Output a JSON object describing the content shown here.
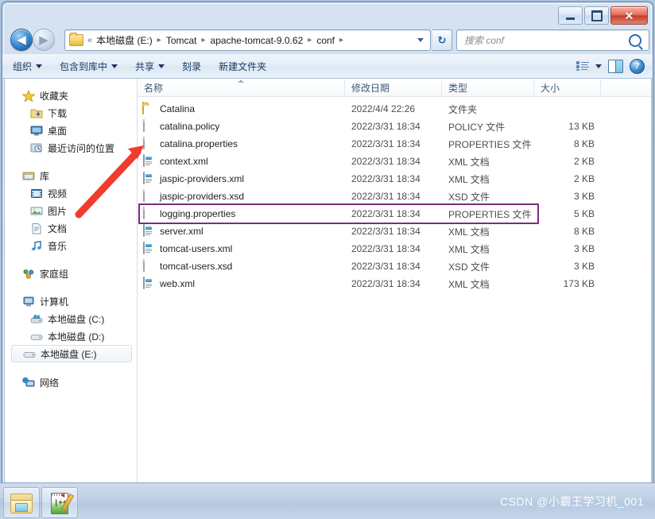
{
  "window": {
    "controls": {
      "minimize_label": "–",
      "maximize_label": "□",
      "close_label": "✕"
    }
  },
  "nav": {
    "back_label": "◀",
    "forward_label": "▶",
    "address": {
      "prefix": "«",
      "crumbs": [
        "本地磁盘 (E:)",
        "Tomcat",
        "apache-tomcat-9.0.62",
        "conf"
      ],
      "separator": "▸"
    },
    "refresh_label": "↻",
    "search": {
      "placeholder": "搜索 conf",
      "value": ""
    }
  },
  "toolbar": {
    "items": [
      {
        "label": "组织",
        "has_caret": true
      },
      {
        "label": "包含到库中",
        "has_caret": true
      },
      {
        "label": "共享",
        "has_caret": true
      },
      {
        "label": "刻录",
        "has_caret": false
      },
      {
        "label": "新建文件夹",
        "has_caret": false
      }
    ],
    "help_label": "?"
  },
  "sidebar": {
    "groups": [
      {
        "header": {
          "label": "收藏夹",
          "icon": "star-icon"
        },
        "items": [
          {
            "label": "下载",
            "icon": "downloads-icon"
          },
          {
            "label": "桌面",
            "icon": "desktop-icon"
          },
          {
            "label": "最近访问的位置",
            "icon": "recent-places-icon"
          }
        ]
      },
      {
        "header": {
          "label": "库",
          "icon": "library-icon"
        },
        "items": [
          {
            "label": "视频",
            "icon": "videos-icon"
          },
          {
            "label": "图片",
            "icon": "pictures-icon"
          },
          {
            "label": "文档",
            "icon": "documents-icon"
          },
          {
            "label": "音乐",
            "icon": "music-icon"
          }
        ]
      },
      {
        "header": {
          "label": "家庭组",
          "icon": "homegroup-icon"
        },
        "items": []
      },
      {
        "header": {
          "label": "计算机",
          "icon": "computer-icon"
        },
        "items": [
          {
            "label": "本地磁盘 (C:)",
            "icon": "system-drive-icon",
            "selected": false
          },
          {
            "label": "本地磁盘 (D:)",
            "icon": "drive-icon",
            "selected": false
          },
          {
            "label": "本地磁盘 (E:)",
            "icon": "drive-icon",
            "selected": true
          }
        ]
      },
      {
        "header": {
          "label": "网络",
          "icon": "network-icon"
        },
        "items": []
      }
    ]
  },
  "filelist": {
    "columns": [
      {
        "key": "name",
        "label": "名称",
        "sorted": true
      },
      {
        "key": "date",
        "label": "修改日期",
        "sorted": false
      },
      {
        "key": "type",
        "label": "类型",
        "sorted": false
      },
      {
        "key": "size",
        "label": "大小",
        "sorted": false
      }
    ],
    "rows": [
      {
        "name": "Catalina",
        "date": "2022/4/4 22:26",
        "type": "文件夹",
        "size": "",
        "icon": "folder-icon",
        "highlighted": false
      },
      {
        "name": "catalina.policy",
        "date": "2022/3/31 18:34",
        "type": "POLICY 文件",
        "size": "13 KB",
        "icon": "page-icon",
        "highlighted": false
      },
      {
        "name": "catalina.properties",
        "date": "2022/3/31 18:34",
        "type": "PROPERTIES 文件",
        "size": "8 KB",
        "icon": "page-icon",
        "highlighted": false
      },
      {
        "name": "context.xml",
        "date": "2022/3/31 18:34",
        "type": "XML 文档",
        "size": "2 KB",
        "icon": "xml-file-icon",
        "highlighted": false
      },
      {
        "name": "jaspic-providers.xml",
        "date": "2022/3/31 18:34",
        "type": "XML 文档",
        "size": "2 KB",
        "icon": "xml-file-icon",
        "highlighted": false
      },
      {
        "name": "jaspic-providers.xsd",
        "date": "2022/3/31 18:34",
        "type": "XSD 文件",
        "size": "3 KB",
        "icon": "page-icon",
        "highlighted": false
      },
      {
        "name": "logging.properties",
        "date": "2022/3/31 18:34",
        "type": "PROPERTIES 文件",
        "size": "5 KB",
        "icon": "page-icon",
        "highlighted": true
      },
      {
        "name": "server.xml",
        "date": "2022/3/31 18:34",
        "type": "XML 文档",
        "size": "8 KB",
        "icon": "xml-file-icon",
        "highlighted": false
      },
      {
        "name": "tomcat-users.xml",
        "date": "2022/3/31 18:34",
        "type": "XML 文档",
        "size": "3 KB",
        "icon": "xml-file-icon",
        "highlighted": false
      },
      {
        "name": "tomcat-users.xsd",
        "date": "2022/3/31 18:34",
        "type": "XSD 文件",
        "size": "3 KB",
        "icon": "page-icon",
        "highlighted": false
      },
      {
        "name": "web.xml",
        "date": "2022/3/31 18:34",
        "type": "XML 文档",
        "size": "173 KB",
        "icon": "xml-file-icon",
        "highlighted": false
      }
    ]
  },
  "annotations": {
    "highlight_color": "#7b2d7b",
    "arrow_color": "#f03c2e",
    "arrow_target": "logging.properties"
  },
  "taskbar": {
    "buttons": [
      {
        "name": "windows-explorer",
        "icon": "explorer-folder-icon"
      },
      {
        "name": "notepad-plus-plus",
        "icon": "notepadpp-icon"
      }
    ],
    "watermark": "CSDN @小霸王学习机_001"
  }
}
